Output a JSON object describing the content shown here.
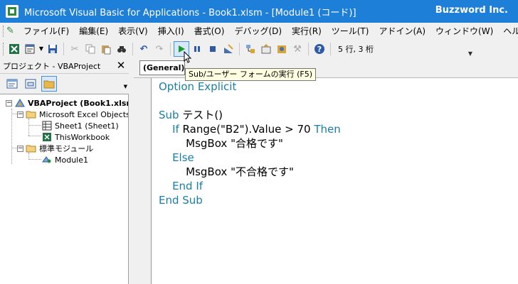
{
  "window": {
    "title": "Microsoft Visual Basic for Applications - Book1.xlsm - [Module1 (コード)]",
    "brand": "Buzzword Inc."
  },
  "menu": {
    "items": [
      "ファイル(F)",
      "編集(E)",
      "表示(V)",
      "挿入(I)",
      "書式(O)",
      "デバッグ(D)",
      "実行(R)",
      "ツール(T)",
      "アドイン(A)",
      "ウィンドウ(W)",
      "ヘルプ(H)"
    ]
  },
  "toolbar": {
    "position": "5 行, 3 桁",
    "icons": [
      "excel-icon",
      "insert-module-icon",
      "save-icon",
      "cut-icon",
      "copy-icon",
      "paste-icon",
      "find-icon",
      "undo-icon",
      "redo-icon",
      "run-icon",
      "pause-icon",
      "reset-icon",
      "design-mode-icon",
      "project-explorer-icon",
      "properties-icon",
      "object-browser-icon",
      "toolbox-icon",
      "help-icon"
    ]
  },
  "tooltip": "Sub/ユーザー フォームの実行 (F5)",
  "project": {
    "header": "プロジェクト - VBAProject",
    "tree": {
      "root": "VBAProject (Book1.xlsm)",
      "excel_objects": "Microsoft Excel Objects",
      "sheet1": "Sheet1 (Sheet1)",
      "thisworkbook": "ThisWorkbook",
      "modules_folder": "標準モジュール",
      "module1": "Module1"
    }
  },
  "code": {
    "object_combo": "(General)",
    "lines": [
      [
        {
          "t": "Option Explicit",
          "k": true
        }
      ],
      [],
      [
        {
          "t": "Sub",
          "k": true
        },
        {
          "t": " テスト()",
          "k": false
        }
      ],
      [
        {
          "t": "    If",
          "k": true
        },
        {
          "t": " Range(\"B2\").Value > 70 ",
          "k": false
        },
        {
          "t": "Then",
          "k": true
        }
      ],
      [
        {
          "t": "        MsgBox \"合格です\"",
          "k": false
        }
      ],
      [
        {
          "t": "    Else",
          "k": true
        }
      ],
      [
        {
          "t": "        MsgBox \"不合格です\"",
          "k": false
        }
      ],
      [
        {
          "t": "    End If",
          "k": true
        }
      ],
      [
        {
          "t": "End Sub",
          "k": true
        }
      ]
    ]
  },
  "colors": {
    "titlebar": "#1e7fd8",
    "keyword": "#1a7fa6",
    "tooltip_bg": "#ffffe1"
  }
}
